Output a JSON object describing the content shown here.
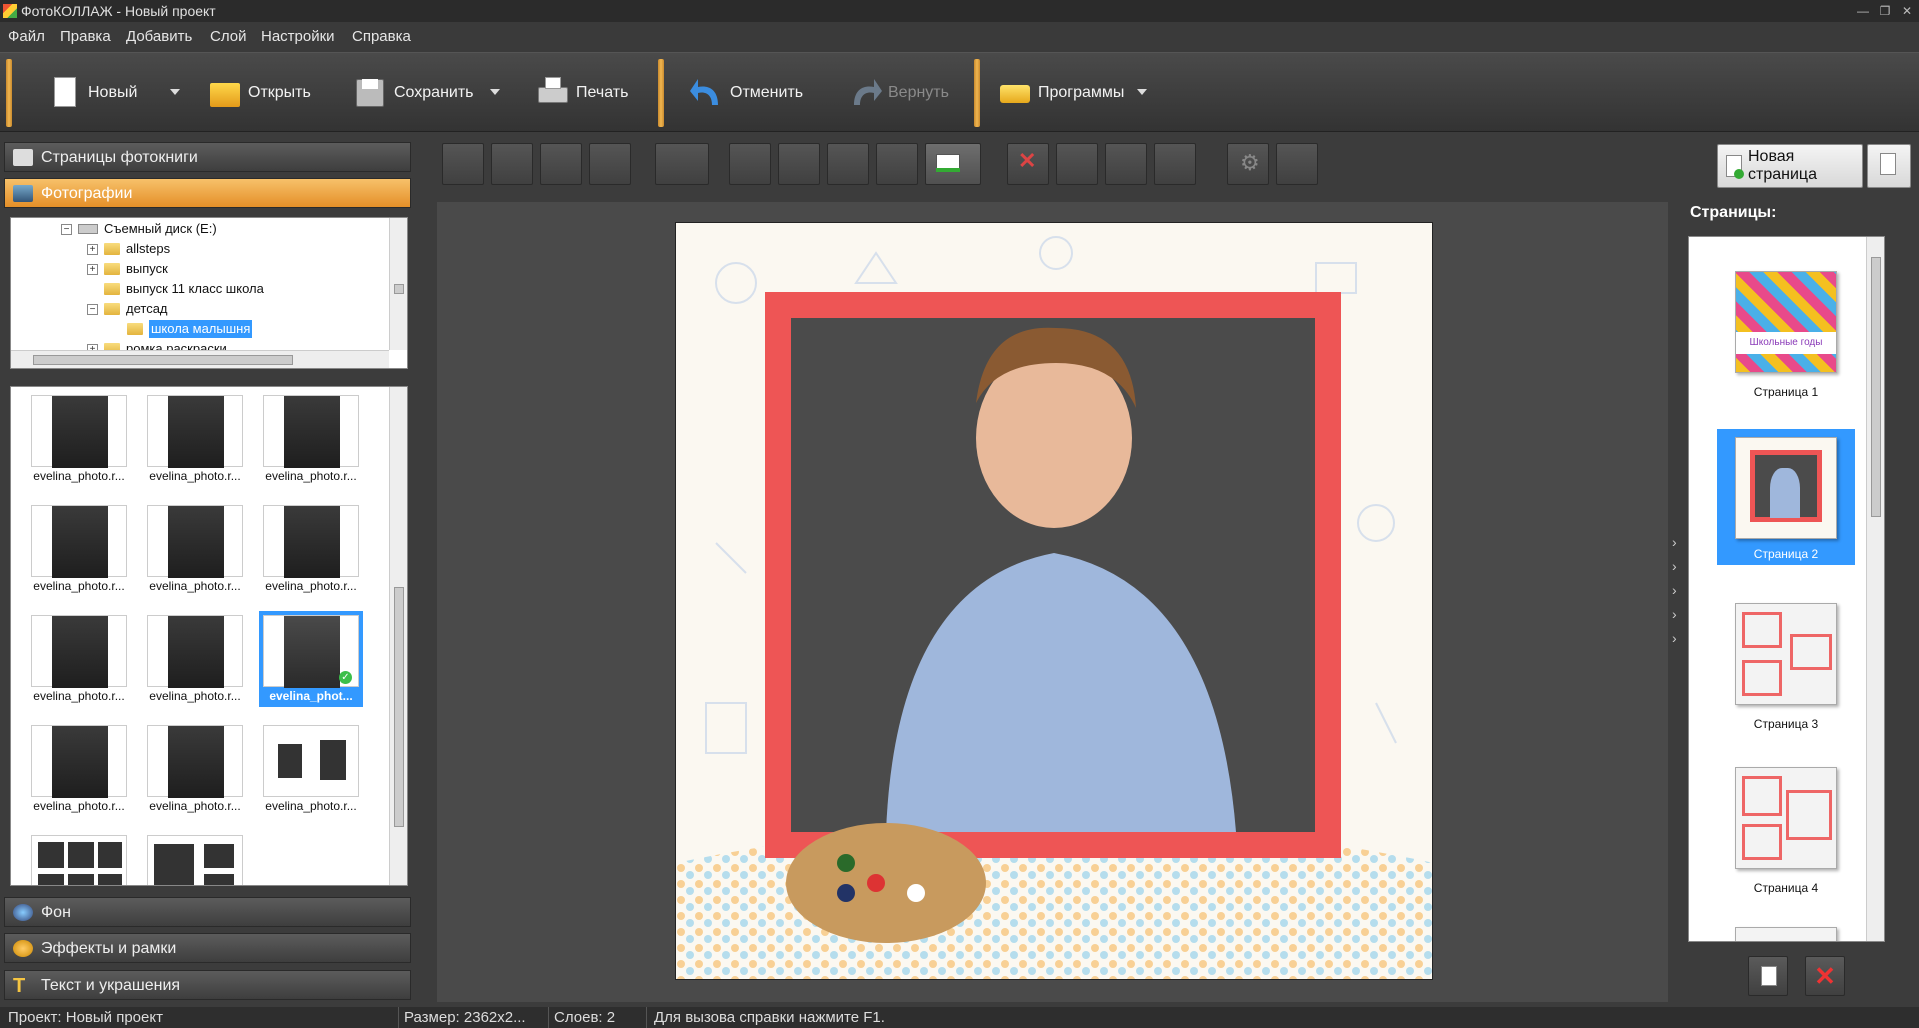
{
  "window": {
    "title": "ФотоКОЛЛАЖ - Новый проект"
  },
  "menu": [
    "Файл",
    "Правка",
    "Добавить",
    "Слой",
    "Настройки",
    "Справка"
  ],
  "toolbar": {
    "new": "Новый",
    "open": "Открыть",
    "save": "Сохранить",
    "print": "Печать",
    "undo": "Отменить",
    "redo": "Вернуть",
    "programs": "Программы"
  },
  "left_panel": {
    "sections_top": [
      "Страницы фотокниги",
      "Фотографии"
    ],
    "sections_bottom": [
      "Фон",
      "Эффекты и рамки",
      "Текст и украшения"
    ],
    "tree": [
      {
        "label": "Съемный диск (E:)",
        "expander": "−"
      },
      {
        "label": "allsteps",
        "expander": "+"
      },
      {
        "label": "выпуск",
        "expander": "+"
      },
      {
        "label": "выпуск 11 класс школа",
        "expander": ""
      },
      {
        "label": "детсад",
        "expander": "−"
      },
      {
        "label": "школа малышня",
        "expander": ""
      },
      {
        "label": "ромка раскраски",
        "expander": "+"
      }
    ],
    "thumbnails": [
      "evelina_photo.r...",
      "evelina_photo.r...",
      "evelina_photo.r...",
      "evelina_photo.r...",
      "evelina_photo.r...",
      "evelina_photo.r...",
      "evelina_photo.r...",
      "evelina_photo.r...",
      "evelina_phot...",
      "evelina_photo.r...",
      "evelina_photo.r...",
      "evelina_photo.r...",
      "",
      ""
    ],
    "selected_thumbnail_index": 8
  },
  "right_panel": {
    "new_page_button": "Новая страница",
    "pages_label": "Страницы:",
    "pages": [
      "Страница 1",
      "Страница 2",
      "Страница 3",
      "Страница 4"
    ],
    "selected_page_index": 1,
    "page1_caption": "Школьные годы"
  },
  "status": {
    "project": "Проект:  Новый проект",
    "size": "Размер:  2362x2...",
    "layers": "Слоев:  2",
    "help": "Для вызова справки нажмите F1."
  },
  "colors": {
    "accent_orange": "#f0a23a",
    "selection_blue": "#3399ff",
    "frame_red": "#ee5555"
  }
}
